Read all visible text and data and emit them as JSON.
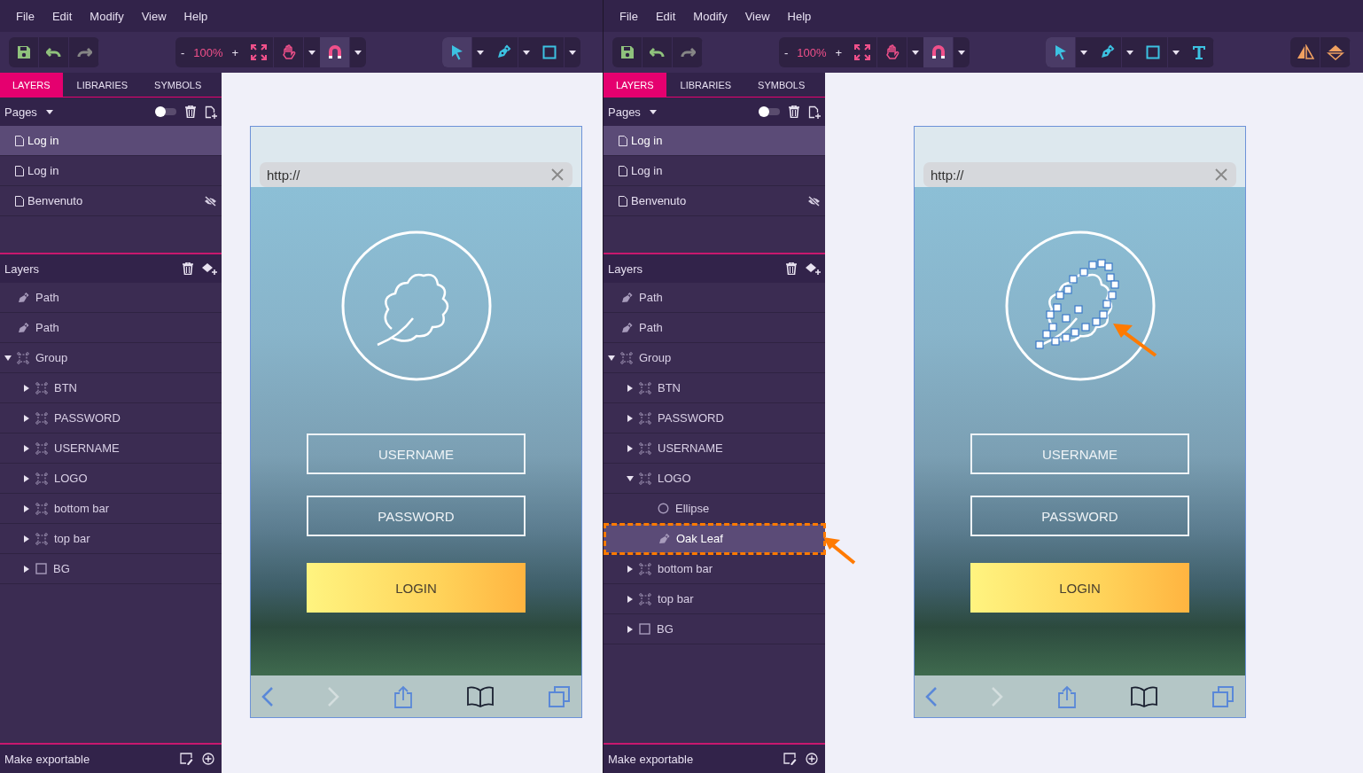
{
  "windows": [
    {
      "menu": [
        {
          "label": "File"
        },
        {
          "label": "Edit"
        },
        {
          "label": "Modify"
        },
        {
          "label": "View"
        },
        {
          "label": "Help"
        }
      ],
      "toolbar": {
        "history": [
          {
            "kind": "save",
            "disabled": false
          },
          {
            "kind": "undo",
            "disabled": false
          },
          {
            "kind": "redo",
            "disabled": true
          }
        ],
        "zoom_out": "-",
        "zoom": "100%",
        "zoom_in": "+",
        "snap": true,
        "tools": [
          {
            "kind": "select",
            "selected": true,
            "menu": true
          },
          {
            "kind": "pen",
            "selected": false,
            "menu": true
          },
          {
            "kind": "rect",
            "selected": false,
            "menu": true
          }
        ]
      },
      "tabs": [
        {
          "label": "LAYERS",
          "selected": true
        },
        {
          "label": "LIBRARIES",
          "selected": false
        },
        {
          "label": "SYMBOLS",
          "selected": false
        }
      ],
      "pages": {
        "title": "Pages",
        "toggle_on": false,
        "items": [
          {
            "name": "Log in",
            "selected": true,
            "hidden": false
          },
          {
            "name": "Log in",
            "selected": false,
            "hidden": false
          },
          {
            "name": "Benvenuto",
            "selected": false,
            "hidden": true
          }
        ]
      },
      "layers": {
        "title": "Layers",
        "items": [
          {
            "name": "Path",
            "kind": "path",
            "selected": false,
            "callout": false
          },
          {
            "name": "Path",
            "kind": "path",
            "selected": false,
            "callout": false
          },
          {
            "name": "Group",
            "kind": "group",
            "expanded": true,
            "selected": false,
            "callout": false,
            "children": [
              {
                "name": "BTN",
                "kind": "group",
                "expanded": false,
                "selected": false,
                "callout": false
              },
              {
                "name": "PASSWORD",
                "kind": "group",
                "expanded": false,
                "selected": false,
                "callout": false
              },
              {
                "name": "USERNAME",
                "kind": "group",
                "expanded": false,
                "selected": false,
                "callout": false
              },
              {
                "name": "LOGO",
                "kind": "group",
                "expanded": false,
                "selected": false,
                "callout": false
              },
              {
                "name": "bottom bar",
                "kind": "group",
                "expanded": false,
                "selected": false,
                "callout": false
              },
              {
                "name": "top bar",
                "kind": "group",
                "expanded": false,
                "selected": false,
                "callout": false
              },
              {
                "name": "BG",
                "kind": "rect",
                "expanded": false,
                "selected": false,
                "callout": false
              }
            ]
          }
        ]
      },
      "footer": {
        "label": "Make exportable"
      },
      "mockup": {
        "url": "http://",
        "fields": [
          {
            "label": "USERNAME"
          },
          {
            "label": "PASSWORD"
          }
        ],
        "button": "LOGIN",
        "logo_editing": false
      }
    },
    {
      "menu": [
        {
          "label": "File"
        },
        {
          "label": "Edit"
        },
        {
          "label": "Modify"
        },
        {
          "label": "View"
        },
        {
          "label": "Help"
        }
      ],
      "toolbar": {
        "history": [
          {
            "kind": "save",
            "disabled": false
          },
          {
            "kind": "undo",
            "disabled": false
          },
          {
            "kind": "redo",
            "disabled": true
          }
        ],
        "zoom_out": "-",
        "zoom": "100%",
        "zoom_in": "+",
        "snap": true,
        "tools": [
          {
            "kind": "select",
            "selected": true,
            "menu": true
          },
          {
            "kind": "pen",
            "selected": false,
            "menu": true
          },
          {
            "kind": "rect",
            "selected": false,
            "menu": true
          },
          {
            "kind": "text",
            "selected": false
          }
        ],
        "arrange": [
          {
            "kind": "flip-horizontal"
          },
          {
            "kind": "flip-vertical"
          }
        ]
      },
      "tabs": [
        {
          "label": "LAYERS",
          "selected": true
        },
        {
          "label": "LIBRARIES",
          "selected": false
        },
        {
          "label": "SYMBOLS",
          "selected": false
        }
      ],
      "pages": {
        "title": "Pages",
        "toggle_on": false,
        "items": [
          {
            "name": "Log in",
            "selected": true,
            "hidden": false
          },
          {
            "name": "Log in",
            "selected": false,
            "hidden": false
          },
          {
            "name": "Benvenuto",
            "selected": false,
            "hidden": true
          }
        ]
      },
      "layers": {
        "title": "Layers",
        "items": [
          {
            "name": "Path",
            "kind": "path",
            "selected": false,
            "callout": false
          },
          {
            "name": "Path",
            "kind": "path",
            "selected": false,
            "callout": false
          },
          {
            "name": "Group",
            "kind": "group",
            "expanded": true,
            "selected": false,
            "callout": false,
            "children": [
              {
                "name": "BTN",
                "kind": "group",
                "expanded": false,
                "selected": false,
                "callout": false
              },
              {
                "name": "PASSWORD",
                "kind": "group",
                "expanded": false,
                "selected": false,
                "callout": false
              },
              {
                "name": "USERNAME",
                "kind": "group",
                "expanded": false,
                "selected": false,
                "callout": false
              },
              {
                "name": "LOGO",
                "kind": "group",
                "expanded": true,
                "selected": false,
                "callout": false,
                "children": [
                  {
                    "name": "Ellipse",
                    "kind": "ellipse",
                    "selected": false,
                    "callout": false
                  },
                  {
                    "name": "Oak Leaf",
                    "kind": "path",
                    "selected": true,
                    "callout": true
                  }
                ]
              },
              {
                "name": "bottom bar",
                "kind": "group",
                "expanded": false,
                "selected": false,
                "callout": false
              },
              {
                "name": "top bar",
                "kind": "group",
                "expanded": false,
                "selected": false,
                "callout": false
              },
              {
                "name": "BG",
                "kind": "rect",
                "expanded": false,
                "selected": false,
                "callout": false
              }
            ]
          }
        ]
      },
      "footer": {
        "label": "Make exportable"
      },
      "mockup": {
        "url": "http://",
        "fields": [
          {
            "label": "USERNAME"
          },
          {
            "label": "PASSWORD"
          }
        ],
        "button": "LOGIN",
        "logo_editing": true,
        "callout": true
      }
    }
  ]
}
